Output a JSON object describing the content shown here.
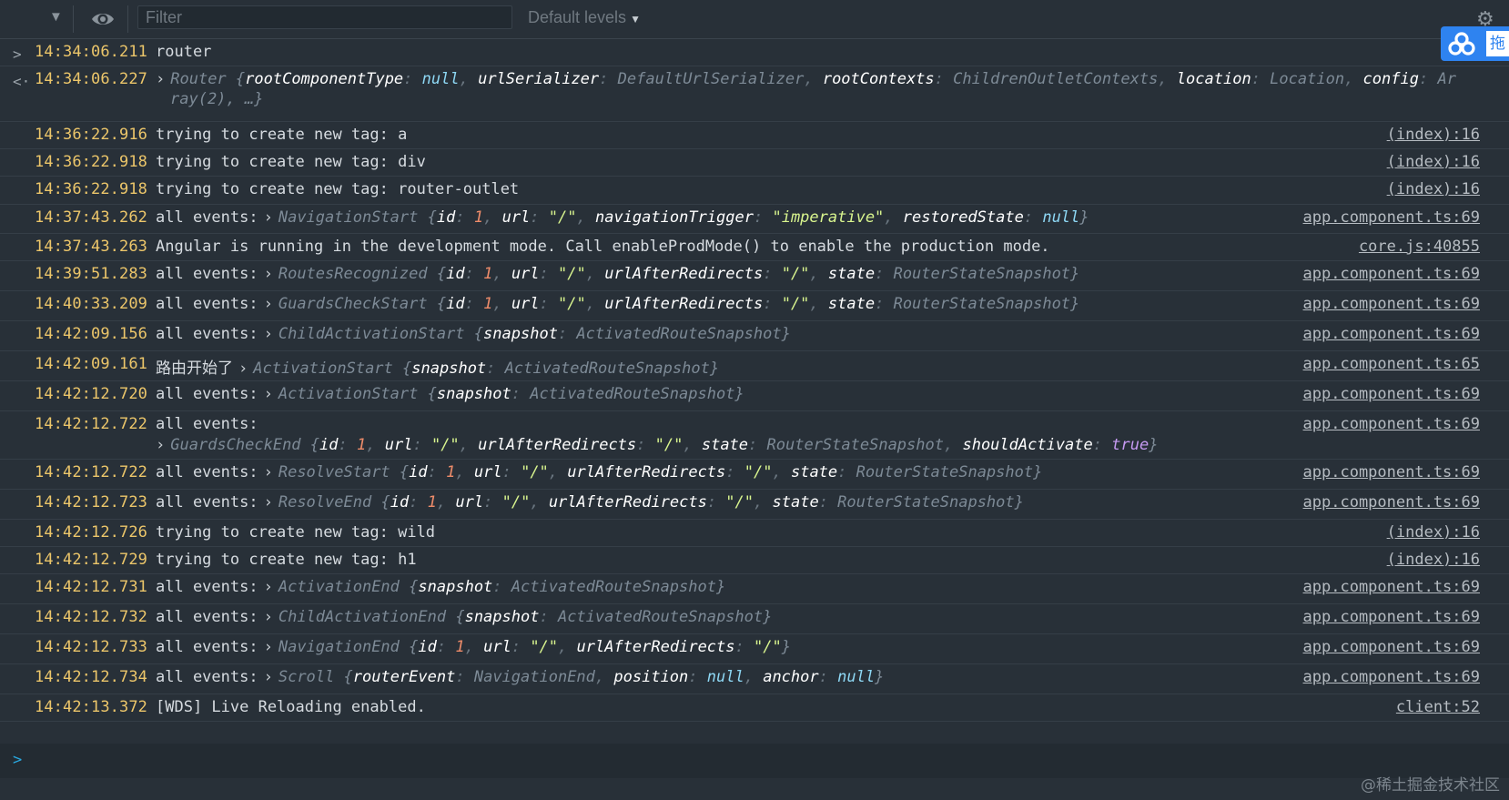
{
  "toolbar": {
    "filter_placeholder": "Filter",
    "levels_label": "Default levels",
    "levels_caret": "▼"
  },
  "badge": {
    "text": "拖"
  },
  "watermark": "@稀土掘金技术社区",
  "colors": {
    "background": "#283038",
    "timestamp": "#ecc66a",
    "number": "#ee8c6a",
    "string": "#d8f48e",
    "null": "#8ed8f5",
    "boolean": "#c69af2",
    "prompt_arrow": "#29a8e0",
    "badge": "#2e83f0"
  },
  "icons": {
    "dropdown": "caret-down-icon",
    "eye": "eye-icon",
    "settings": "gear-icon",
    "input_arrow": "chevron-right-icon",
    "result_arrow": "return-arrow-icon",
    "expand": "expand-triangle-icon"
  },
  "rows": [
    {
      "arrow": ">",
      "time": "14:34:06.211",
      "text": "router"
    },
    {
      "arrow": "<·",
      "time": "14:34:06.227",
      "obj_class": "Router",
      "line1_parts": [
        "{",
        "rootComponentType",
        ": ",
        "null",
        ", ",
        "urlSerializer",
        ": ",
        "DefaultUrlSerializer",
        ", ",
        "rootContexts",
        ": ",
        "ChildrenOutletContexts",
        ", ",
        "location",
        ": ",
        "Location",
        ", ",
        "config",
        ": ",
        "Ar"
      ],
      "line2": "ray(2), …}"
    },
    {
      "time": "14:36:22.916",
      "text": "trying to create new tag: a",
      "src": "(index):16"
    },
    {
      "time": "14:36:22.918",
      "text": "trying to create new tag: div",
      "src": "(index):16"
    },
    {
      "time": "14:36:22.918",
      "text": "trying to create new tag: router-outlet",
      "src": "(index):16"
    },
    {
      "time": "14:37:43.262",
      "prefix": "all events:",
      "obj_class": "NavigationStart",
      "parts": [
        "{",
        "id",
        ": ",
        "1",
        ", ",
        "url",
        ": ",
        "\"/\"",
        ", ",
        "navigationTrigger",
        ": ",
        "\"imperative\"",
        ", ",
        "restoredState",
        ": ",
        "null",
        "}"
      ],
      "src": "app.component.ts:69"
    },
    {
      "time": "14:37:43.263",
      "text": "Angular is running in the development mode. Call enableProdMode() to enable the production mode.",
      "src": "core.js:40855"
    },
    {
      "time": "14:39:51.283",
      "prefix": "all events:",
      "obj_class": "RoutesRecognized",
      "parts": [
        "{",
        "id",
        ": ",
        "1",
        ", ",
        "url",
        ": ",
        "\"/\"",
        ", ",
        "urlAfterRedirects",
        ": ",
        "\"/\"",
        ", ",
        "state",
        ": ",
        "RouterStateSnapshot",
        "}"
      ],
      "src": "app.component.ts:69"
    },
    {
      "time": "14:40:33.209",
      "prefix": "all events:",
      "obj_class": "GuardsCheckStart",
      "parts": [
        "{",
        "id",
        ": ",
        "1",
        ", ",
        "url",
        ": ",
        "\"/\"",
        ", ",
        "urlAfterRedirects",
        ": ",
        "\"/\"",
        ", ",
        "state",
        ": ",
        "RouterStateSnapshot",
        "}"
      ],
      "src": "app.component.ts:69"
    },
    {
      "time": "14:42:09.156",
      "prefix": "all events:",
      "obj_class": "ChildActivationStart",
      "parts": [
        "{",
        "snapshot",
        ": ",
        "ActivatedRouteSnapshot",
        "}"
      ],
      "src": "app.component.ts:69"
    },
    {
      "time": "14:42:09.161",
      "prefix": "路由开始了",
      "obj_class": "ActivationStart",
      "parts": [
        "{",
        "snapshot",
        ": ",
        "ActivatedRouteSnapshot",
        "}"
      ],
      "src": "app.component.ts:65"
    },
    {
      "time": "14:42:12.720",
      "prefix": "all events:",
      "obj_class": "ActivationStart",
      "parts": [
        "{",
        "snapshot",
        ": ",
        "ActivatedRouteSnapshot",
        "}"
      ],
      "src": "app.component.ts:69"
    },
    {
      "time": "14:42:12.722",
      "prefix": "all events:",
      "obj_class": "GuardsCheckEnd",
      "wrap": true,
      "parts": [
        "{",
        "id",
        ": ",
        "1",
        ", ",
        "url",
        ": ",
        "\"/\"",
        ", ",
        "urlAfterRedirects",
        ": ",
        "\"/\"",
        ", ",
        "state",
        ": ",
        "RouterStateSnapshot",
        ", ",
        "shouldActivate",
        ": ",
        "true",
        "}"
      ],
      "src": "app.component.ts:69"
    },
    {
      "time": "14:42:12.722",
      "prefix": "all events:",
      "obj_class": "ResolveStart",
      "parts": [
        "{",
        "id",
        ": ",
        "1",
        ", ",
        "url",
        ": ",
        "\"/\"",
        ", ",
        "urlAfterRedirects",
        ": ",
        "\"/\"",
        ", ",
        "state",
        ": ",
        "RouterStateSnapshot",
        "}"
      ],
      "src": "app.component.ts:69"
    },
    {
      "time": "14:42:12.723",
      "prefix": "all events:",
      "obj_class": "ResolveEnd",
      "parts": [
        "{",
        "id",
        ": ",
        "1",
        ", ",
        "url",
        ": ",
        "\"/\"",
        ", ",
        "urlAfterRedirects",
        ": ",
        "\"/\"",
        ", ",
        "state",
        ": ",
        "RouterStateSnapshot",
        "}"
      ],
      "src": "app.component.ts:69"
    },
    {
      "time": "14:42:12.726",
      "text": "trying to create new tag: wild",
      "src": "(index):16"
    },
    {
      "time": "14:42:12.729",
      "text": "trying to create new tag: h1",
      "src": "(index):16"
    },
    {
      "time": "14:42:12.731",
      "prefix": "all events:",
      "obj_class": "ActivationEnd",
      "parts": [
        "{",
        "snapshot",
        ": ",
        "ActivatedRouteSnapshot",
        "}"
      ],
      "src": "app.component.ts:69"
    },
    {
      "time": "14:42:12.732",
      "prefix": "all events:",
      "obj_class": "ChildActivationEnd",
      "parts": [
        "{",
        "snapshot",
        ": ",
        "ActivatedRouteSnapshot",
        "}"
      ],
      "src": "app.component.ts:69"
    },
    {
      "time": "14:42:12.733",
      "prefix": "all events:",
      "obj_class": "NavigationEnd",
      "parts": [
        "{",
        "id",
        ": ",
        "1",
        ", ",
        "url",
        ": ",
        "\"/\"",
        ", ",
        "urlAfterRedirects",
        ": ",
        "\"/\"",
        "}"
      ],
      "src": "app.component.ts:69"
    },
    {
      "time": "14:42:12.734",
      "prefix": "all events:",
      "obj_class": "Scroll",
      "parts": [
        "{",
        "routerEvent",
        ": ",
        "NavigationEnd",
        ", ",
        "position",
        ": ",
        "null",
        ", ",
        "anchor",
        ": ",
        "null",
        "}"
      ],
      "src": "app.component.ts:69"
    },
    {
      "time": "14:42:13.372",
      "text": "[WDS] Live Reloading enabled.",
      "src": "client:52"
    }
  ],
  "prompt": {
    "symbol": ">",
    "value": ""
  }
}
